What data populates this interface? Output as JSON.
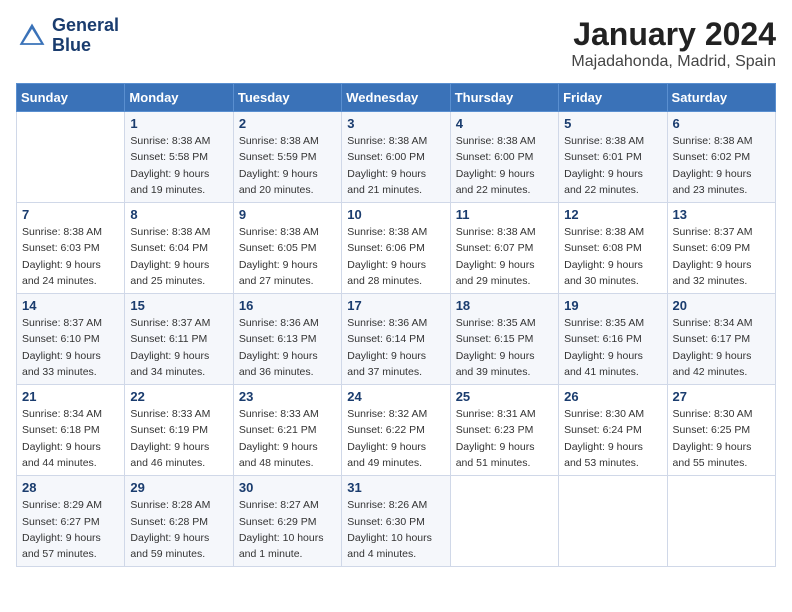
{
  "logo": {
    "line1": "General",
    "line2": "Blue"
  },
  "title": "January 2024",
  "location": "Majadahonda, Madrid, Spain",
  "days_of_week": [
    "Sunday",
    "Monday",
    "Tuesday",
    "Wednesday",
    "Thursday",
    "Friday",
    "Saturday"
  ],
  "weeks": [
    [
      {
        "num": "",
        "info": ""
      },
      {
        "num": "1",
        "info": "Sunrise: 8:38 AM\nSunset: 5:58 PM\nDaylight: 9 hours\nand 19 minutes."
      },
      {
        "num": "2",
        "info": "Sunrise: 8:38 AM\nSunset: 5:59 PM\nDaylight: 9 hours\nand 20 minutes."
      },
      {
        "num": "3",
        "info": "Sunrise: 8:38 AM\nSunset: 6:00 PM\nDaylight: 9 hours\nand 21 minutes."
      },
      {
        "num": "4",
        "info": "Sunrise: 8:38 AM\nSunset: 6:00 PM\nDaylight: 9 hours\nand 22 minutes."
      },
      {
        "num": "5",
        "info": "Sunrise: 8:38 AM\nSunset: 6:01 PM\nDaylight: 9 hours\nand 22 minutes."
      },
      {
        "num": "6",
        "info": "Sunrise: 8:38 AM\nSunset: 6:02 PM\nDaylight: 9 hours\nand 23 minutes."
      }
    ],
    [
      {
        "num": "7",
        "info": "Sunrise: 8:38 AM\nSunset: 6:03 PM\nDaylight: 9 hours\nand 24 minutes."
      },
      {
        "num": "8",
        "info": "Sunrise: 8:38 AM\nSunset: 6:04 PM\nDaylight: 9 hours\nand 25 minutes."
      },
      {
        "num": "9",
        "info": "Sunrise: 8:38 AM\nSunset: 6:05 PM\nDaylight: 9 hours\nand 27 minutes."
      },
      {
        "num": "10",
        "info": "Sunrise: 8:38 AM\nSunset: 6:06 PM\nDaylight: 9 hours\nand 28 minutes."
      },
      {
        "num": "11",
        "info": "Sunrise: 8:38 AM\nSunset: 6:07 PM\nDaylight: 9 hours\nand 29 minutes."
      },
      {
        "num": "12",
        "info": "Sunrise: 8:38 AM\nSunset: 6:08 PM\nDaylight: 9 hours\nand 30 minutes."
      },
      {
        "num": "13",
        "info": "Sunrise: 8:37 AM\nSunset: 6:09 PM\nDaylight: 9 hours\nand 32 minutes."
      }
    ],
    [
      {
        "num": "14",
        "info": "Sunrise: 8:37 AM\nSunset: 6:10 PM\nDaylight: 9 hours\nand 33 minutes."
      },
      {
        "num": "15",
        "info": "Sunrise: 8:37 AM\nSunset: 6:11 PM\nDaylight: 9 hours\nand 34 minutes."
      },
      {
        "num": "16",
        "info": "Sunrise: 8:36 AM\nSunset: 6:13 PM\nDaylight: 9 hours\nand 36 minutes."
      },
      {
        "num": "17",
        "info": "Sunrise: 8:36 AM\nSunset: 6:14 PM\nDaylight: 9 hours\nand 37 minutes."
      },
      {
        "num": "18",
        "info": "Sunrise: 8:35 AM\nSunset: 6:15 PM\nDaylight: 9 hours\nand 39 minutes."
      },
      {
        "num": "19",
        "info": "Sunrise: 8:35 AM\nSunset: 6:16 PM\nDaylight: 9 hours\nand 41 minutes."
      },
      {
        "num": "20",
        "info": "Sunrise: 8:34 AM\nSunset: 6:17 PM\nDaylight: 9 hours\nand 42 minutes."
      }
    ],
    [
      {
        "num": "21",
        "info": "Sunrise: 8:34 AM\nSunset: 6:18 PM\nDaylight: 9 hours\nand 44 minutes."
      },
      {
        "num": "22",
        "info": "Sunrise: 8:33 AM\nSunset: 6:19 PM\nDaylight: 9 hours\nand 46 minutes."
      },
      {
        "num": "23",
        "info": "Sunrise: 8:33 AM\nSunset: 6:21 PM\nDaylight: 9 hours\nand 48 minutes."
      },
      {
        "num": "24",
        "info": "Sunrise: 8:32 AM\nSunset: 6:22 PM\nDaylight: 9 hours\nand 49 minutes."
      },
      {
        "num": "25",
        "info": "Sunrise: 8:31 AM\nSunset: 6:23 PM\nDaylight: 9 hours\nand 51 minutes."
      },
      {
        "num": "26",
        "info": "Sunrise: 8:30 AM\nSunset: 6:24 PM\nDaylight: 9 hours\nand 53 minutes."
      },
      {
        "num": "27",
        "info": "Sunrise: 8:30 AM\nSunset: 6:25 PM\nDaylight: 9 hours\nand 55 minutes."
      }
    ],
    [
      {
        "num": "28",
        "info": "Sunrise: 8:29 AM\nSunset: 6:27 PM\nDaylight: 9 hours\nand 57 minutes."
      },
      {
        "num": "29",
        "info": "Sunrise: 8:28 AM\nSunset: 6:28 PM\nDaylight: 9 hours\nand 59 minutes."
      },
      {
        "num": "30",
        "info": "Sunrise: 8:27 AM\nSunset: 6:29 PM\nDaylight: 10 hours\nand 1 minute."
      },
      {
        "num": "31",
        "info": "Sunrise: 8:26 AM\nSunset: 6:30 PM\nDaylight: 10 hours\nand 4 minutes."
      },
      {
        "num": "",
        "info": ""
      },
      {
        "num": "",
        "info": ""
      },
      {
        "num": "",
        "info": ""
      }
    ]
  ]
}
